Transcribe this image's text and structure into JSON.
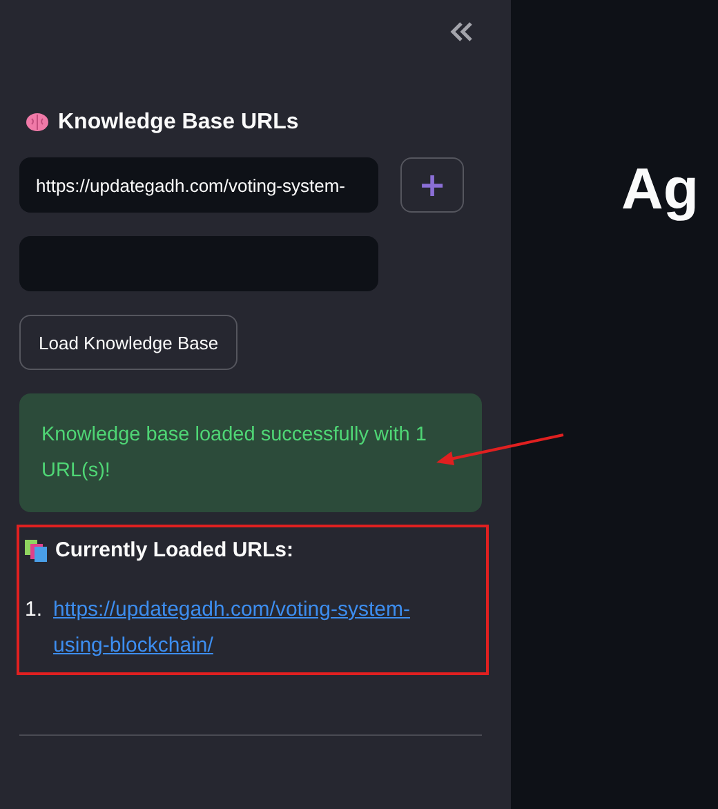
{
  "sidebar": {
    "heading": "Knowledge Base URLs",
    "url_fields": [
      {
        "value": "https://updategadh.com/voting-system-"
      }
    ],
    "add_button": "+",
    "load_button": "Load Knowledge Base",
    "alert": {
      "kind": "success",
      "text": "Knowledge base loaded successfully with 1 URL(s)!"
    },
    "loaded": {
      "heading": "Currently Loaded URLs:",
      "items": [
        {
          "number": "1.",
          "link": "https://updategadh.com/voting-system-using-blockchain/"
        }
      ]
    }
  },
  "main": {
    "title": "Ag"
  }
}
